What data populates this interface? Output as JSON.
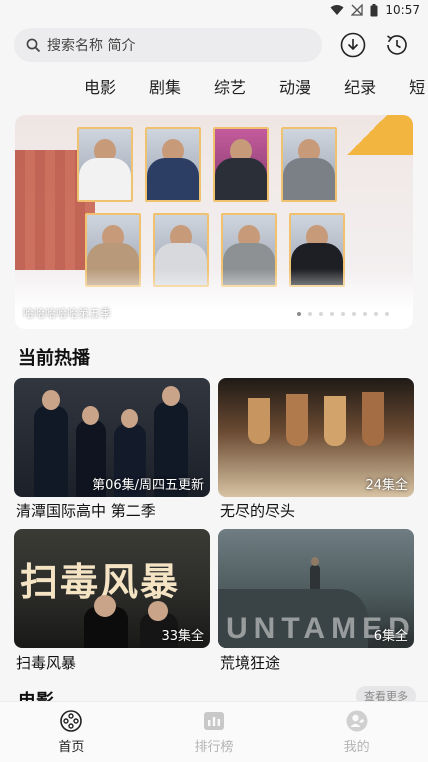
{
  "status": {
    "time": "10:57"
  },
  "search": {
    "placeholder": "搜索名称 简介"
  },
  "tabs": [
    "电影",
    "剧集",
    "综艺",
    "动漫",
    "纪录",
    "短"
  ],
  "banner": {
    "caption": "哈哈哈哈哈第五季",
    "dot_count": 9,
    "active_dot": 1
  },
  "hot": {
    "title": "当前热播",
    "items": [
      {
        "title": "清潭国际高中 第二季",
        "episode": "第06集/周四五更新"
      },
      {
        "title": "无尽的尽头",
        "episode": "24集全"
      },
      {
        "title": "扫毒风暴",
        "episode": "33集全",
        "poster_text": "扫毒风暴"
      },
      {
        "title": "荒境狂途",
        "episode": "6集全",
        "poster_text": "UNTAMED"
      }
    ]
  },
  "movies": {
    "title": "电影",
    "more_label": "查看更多"
  },
  "bottom_nav": [
    {
      "label": "首页",
      "icon": "film-reel-icon",
      "active": true
    },
    {
      "label": "排行榜",
      "icon": "ranking-icon",
      "active": false
    },
    {
      "label": "我的",
      "icon": "profile-icon",
      "active": false
    }
  ],
  "colors": {
    "accent_border": "#f0c270",
    "nav_inactive": "#b4b4b4"
  }
}
